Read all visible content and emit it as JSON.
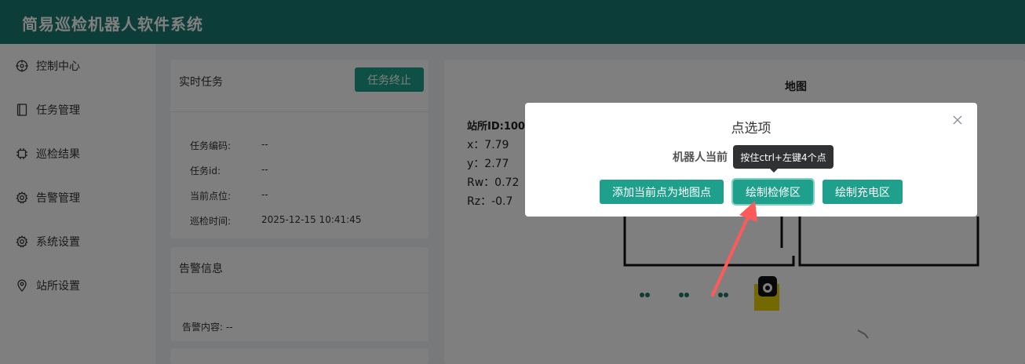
{
  "header": {
    "title": "简易巡检机器人软件系统"
  },
  "sidebar": {
    "items": [
      {
        "label": "控制中心",
        "icon": "crosshair-icon"
      },
      {
        "label": "任务管理",
        "icon": "notebook-icon"
      },
      {
        "label": "巡检结果",
        "icon": "chip-icon"
      },
      {
        "label": "告警管理",
        "icon": "gear-icon"
      },
      {
        "label": "系统设置",
        "icon": "gear-icon"
      },
      {
        "label": "站所设置",
        "icon": "location-pin-icon"
      }
    ]
  },
  "task_card": {
    "title": "实时任务",
    "stop_button": "任务终止",
    "fields": [
      {
        "label": "任务编码:",
        "value": "--"
      },
      {
        "label": "任务id:",
        "value": "--"
      },
      {
        "label": "当前点位:",
        "value": "--"
      },
      {
        "label": "巡检时间:",
        "value": "2025-12-15 10:41:45"
      }
    ]
  },
  "alarm_card": {
    "title": "告警信息",
    "content_label": "告警内容: --"
  },
  "map": {
    "title": "地图",
    "station": "站所ID:100",
    "coords": [
      "x：7.79",
      "y：2.77",
      "Rw：0.72",
      "Rz：-0.7"
    ]
  },
  "dialog": {
    "title": "点选项",
    "subtitle": "机器人当前",
    "buttons": [
      "添加当前点为地图点",
      "绘制检修区",
      "绘制充电区"
    ],
    "tooltip": "按住ctrl+左键4个点"
  },
  "colors": {
    "header": "#1b7a72",
    "accent": "#1fa08d",
    "annotation_arrow": "#ff5a5a"
  }
}
